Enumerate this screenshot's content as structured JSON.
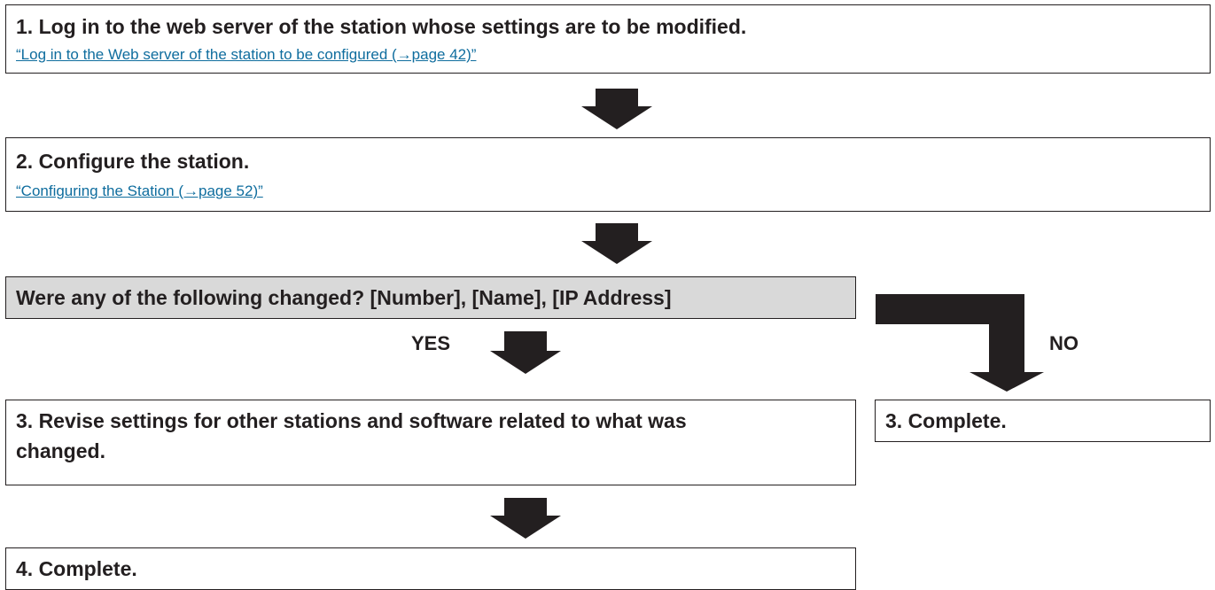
{
  "steps": {
    "step1": {
      "title": "1. Log in to the web server of the station whose settings are to be modified.",
      "link": "“Log in to the Web server of the station to be configured (→page 42)”"
    },
    "step2": {
      "title": "2. Configure the station.",
      "link": "“Configuring the Station (→page 52)”"
    },
    "decision": {
      "question": "Were any of the following changed? [Number], [Name], [IP Address]",
      "yes_label": "YES",
      "no_label": "NO"
    },
    "step3_yes": {
      "title": "3. Revise settings for other stations and software related to what was changed."
    },
    "step3_no": {
      "title": "3. Complete."
    },
    "step4": {
      "title": "4. Complete."
    }
  },
  "colors": {
    "text": "#231f20",
    "link": "#0f6d9e",
    "decision_fill": "#d9d9d9",
    "arrow": "#231f20"
  }
}
